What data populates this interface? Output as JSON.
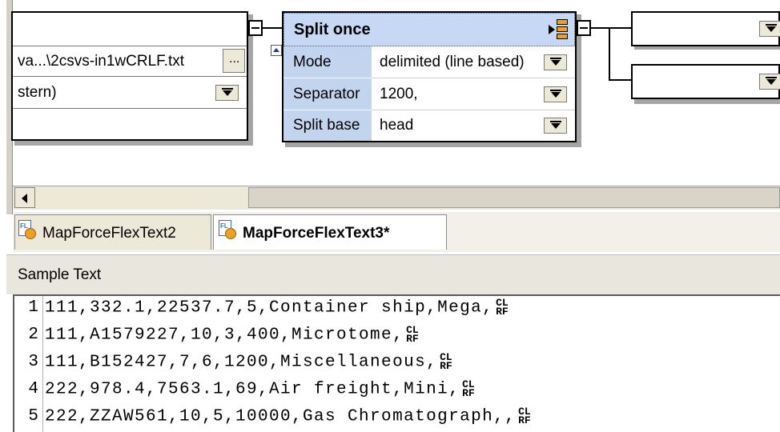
{
  "left_node": {
    "file_value": "va...\\2csvs-in1wCRLF.txt",
    "browse_label": "...",
    "row2_value": "stern)"
  },
  "split_node": {
    "title": "Split once",
    "rows": [
      {
        "label": "Mode",
        "value": "delimited (line based)"
      },
      {
        "label": "Separator",
        "value": "1200,"
      },
      {
        "label": "Split base",
        "value": "head"
      }
    ]
  },
  "tabs": [
    {
      "label": "MapForceFlexText2",
      "active": false
    },
    {
      "label": "MapForceFlexText3*",
      "active": true
    }
  ],
  "sample_text": {
    "header": "Sample Text",
    "lines": [
      {
        "num": "1",
        "text": "111,332.1,22537.7,5,Container ship,Mega,"
      },
      {
        "num": "2",
        "text": "111,A1579227,10,3,400,Microtome,"
      },
      {
        "num": "3",
        "text": "111,B152427,7,6,1200,Miscellaneous,"
      },
      {
        "num": "4",
        "text": "222,978.4,7563.1,69,Air freight,Mini,"
      },
      {
        "num": "5",
        "text": "222,ZZAW561,10,5,10000,Gas Chromatograph,,"
      }
    ],
    "eol_marker": "CR LF"
  },
  "colors": {
    "node_title_bg": "#c6d8f3",
    "node_label_bg": "#c3d4ef",
    "split_icon": "#f0a020"
  }
}
